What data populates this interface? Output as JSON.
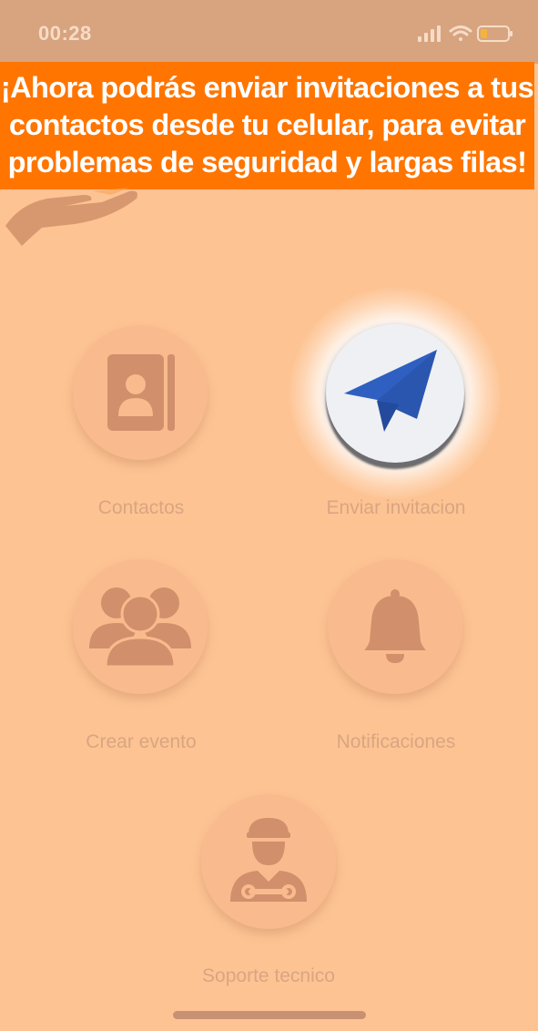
{
  "status_bar": {
    "time": "00:28"
  },
  "banner": {
    "lines": [
      "¡Ahora podrás enviar invitaciones a tus",
      "contactos desde tu celular, para evitar",
      "problemas de seguridad y largas filas!"
    ]
  },
  "menu": {
    "contacts": {
      "label": "Contactos",
      "icon": "contact-book-icon"
    },
    "send_invitation": {
      "label": "Enviar invitacion",
      "icon": "paper-plane-icon"
    },
    "create_event": {
      "label": "Crear evento",
      "icon": "group-icon"
    },
    "notifications": {
      "label": "Notificaciones",
      "icon": "bell-icon"
    },
    "support": {
      "label": "Soporte tecnico",
      "icon": "mechanic-icon"
    }
  },
  "colors": {
    "background": "#fdc393",
    "banner": "#ff7500",
    "icon_muted": "#d18f6c",
    "plane": "#2f5fc0"
  }
}
